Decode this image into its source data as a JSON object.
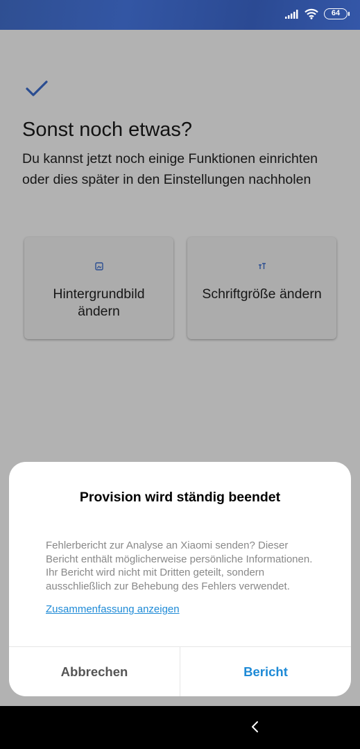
{
  "status_bar": {
    "battery": "64",
    "icons": [
      "signal-icon",
      "wifi-icon",
      "battery-icon"
    ]
  },
  "page": {
    "title": "Sonst noch etwas?",
    "subtitle": "Du kannst jetzt noch einige Funktionen einrichten oder dies später in den Einstellungen nachholen",
    "cards": [
      {
        "icon": "wallpaper-icon",
        "label": "Hintergrundbild ändern"
      },
      {
        "icon": "font-size-icon",
        "label": "Schriftgröße ändern"
      }
    ]
  },
  "dialog": {
    "title": "Provision wird ständig beendet",
    "message": "Fehlerbericht zur Analyse an Xiaomi senden? Dieser Bericht enthält möglicherweise persönliche Informatio­nen. Ihr Bericht wird nicht mit Dritten geteilt, sondern ausschließlich zur Behebung des Fehlers verwendet.",
    "link": "Zusammenfassung anzeigen",
    "cancel_label": "Abbrechen",
    "report_label": "Bericht"
  },
  "colors": {
    "accent": "#1e8ad6",
    "check": "#3d6fd0",
    "status_bar": "#3356a4"
  }
}
